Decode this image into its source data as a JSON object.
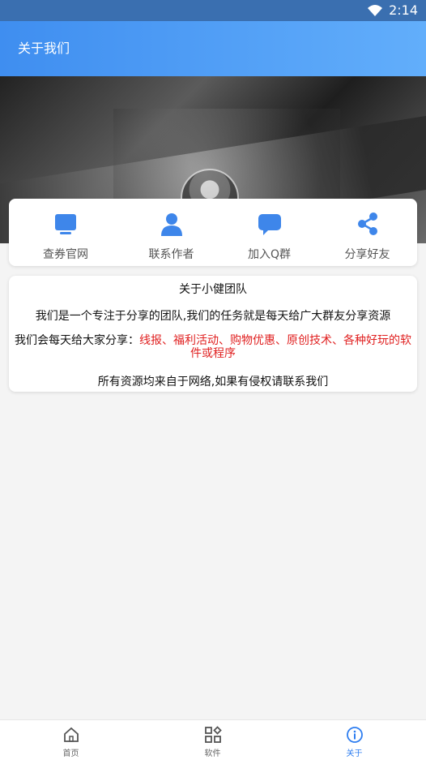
{
  "status_bar": {
    "time": "2:14"
  },
  "app_bar": {
    "title": "关于我们"
  },
  "actions": [
    {
      "label": "查券官网",
      "icon": "monitor-icon"
    },
    {
      "label": "联系作者",
      "icon": "person-icon"
    },
    {
      "label": "加入Q群",
      "icon": "chat-icon"
    },
    {
      "label": "分享好友",
      "icon": "share-icon"
    }
  ],
  "info": {
    "title": "关于小健团队",
    "line1": "我们是一个专注于分享的团队,我们的任务就是每天给广大群友分享资源",
    "line2_prefix": "我们会每天给大家分享：",
    "line2_red": "线报、福利活动、购物优惠、原创技术、各种好玩的软件或程序",
    "line3": "所有资源均来自于网络,如果有侵权请联系我们"
  },
  "bottom_nav": [
    {
      "label": "首页",
      "icon": "home-icon",
      "active": false
    },
    {
      "label": "软件",
      "icon": "apps-icon",
      "active": false
    },
    {
      "label": "关于",
      "icon": "info-icon",
      "active": true
    }
  ],
  "colors": {
    "accent": "#2d7df0",
    "highlight_text": "#e02020"
  }
}
